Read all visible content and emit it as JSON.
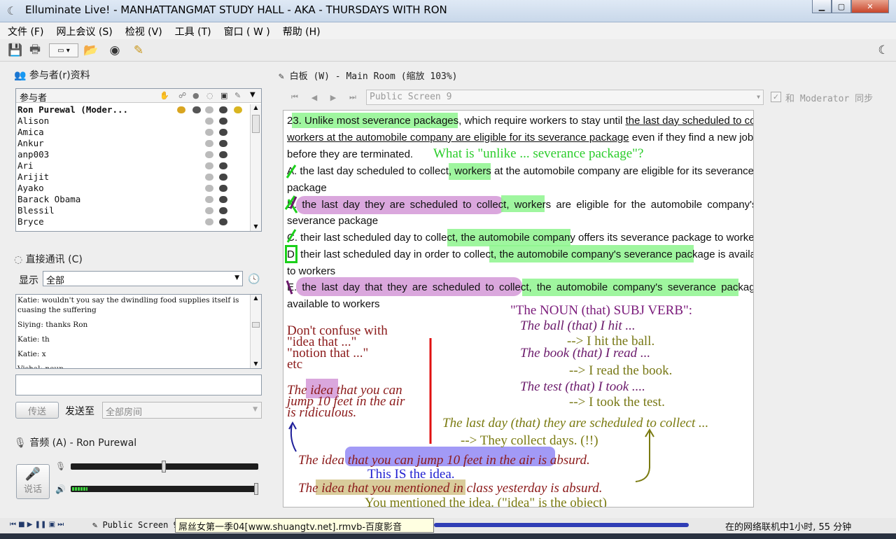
{
  "window": {
    "title": "Elluminate Live! - MANHATTANGMAT STUDY HALL - AKA - THURSDAYS WITH RON"
  },
  "menu": [
    "文件 (F)",
    "网上会议 (S)",
    "检视 (V)",
    "工具 (T)",
    "窗口 ( W )",
    "帮助 (H)"
  ],
  "participants": {
    "title": "参与者(r)资料",
    "header": "参与者",
    "rows": [
      "Ron Purewal (Moder...",
      "Alison",
      "Amica",
      "Ankur",
      "anp003",
      "Ari",
      "Arijit",
      "Ayako",
      "Barack Obama",
      "Blessil",
      "Bryce"
    ]
  },
  "chat": {
    "title": "直接通讯 (C)",
    "show_label": "显示",
    "filter": "全部",
    "messages": [
      "Katie: wouldn't you say the dwindling food supplies itself is cuasing the suffering",
      "Siying: thanks Ron",
      "Katie: th",
      "Katie: x",
      "Vishal: neup"
    ],
    "send_button": "传送",
    "send_to_label": "发送至",
    "send_to_value": "全部房间"
  },
  "audio": {
    "title": "音频 (A) - Ron Purewal",
    "talk_button": "说话"
  },
  "whiteboard": {
    "title": "白板 (W) - Main Room (缩放 103%)",
    "screen": "Public Screen 9",
    "sync_label": "和 Moderator 同步",
    "question": {
      "line1a": "23. Unlike most severance packages, which require workers to stay until ",
      "line1b": "the last day scheduled to collect,",
      "line2a": "workers at the automobile company are eligible for its severance package",
      "line2b": " even if they find a new job",
      "line3": "before they are terminated.",
      "a1": "A. the last day scheduled to collect, workers at the automobile company are eligible for its severance",
      "a2": "package",
      "b1": "B. the last day they are scheduled to collect, workers are eligible for the automobile company's",
      "b2": "severance package",
      "c1": "C. their last scheduled day to collect, the automobile company offers its severance package to workers",
      "d1": "D. their last scheduled day in order to collect, the automobile company's severance package is available",
      "d2": "to workers",
      "e1": "E. the last day that they are scheduled to collect, the automobile company's severance package is",
      "e2": "available to workers"
    },
    "notes": {
      "green_q": "What is \"unlike ... severance package\"?",
      "rule": "\"The NOUN (that) SUBJ VERB\":",
      "ex1": "The ball      (that)   I        hit ...",
      "ex1b": "--> I hit the ball.",
      "ex2": "The book    (that)   I        read ...",
      "ex2b": "--> I read the book.",
      "ex3": "The test      (that)   I        took ....",
      "ex3b": "--> I took the test.",
      "confuse1": "Don't confuse with",
      "confuse2": "\"idea that ...\"",
      "confuse3": "\"notion that ...\"",
      "confuse4": "etc",
      "idea1": "The idea that you can",
      "idea2": "jump 10 feet in the air",
      "idea3": "is ridiculous.",
      "lastday": "The last day  (that)  they are scheduled to collect ...",
      "collect": "--> They collect days.  (!!)",
      "absurd1": "The idea that you can jump 10 feet in the air is absurd.",
      "isidea": "This IS the idea.",
      "absurd2": "The idea that you mentioned in class yesterday is absurd.",
      "mentioned": "You mentioned the idea.  (\"idea\" is the object)"
    }
  },
  "status": {
    "screen": "Public Screen 9",
    "tooltip": "屌丝女第一季04[www.shuangtv.net].rmvb-百度影音",
    "online": "在的网络联机中1小时, 55 分钟"
  },
  "colors": {
    "green": "#8ef58e",
    "purple": "#c16cc6",
    "maroon": "#8b1a1a",
    "olive": "#7a7a10",
    "violet": "#6b1a6b"
  }
}
